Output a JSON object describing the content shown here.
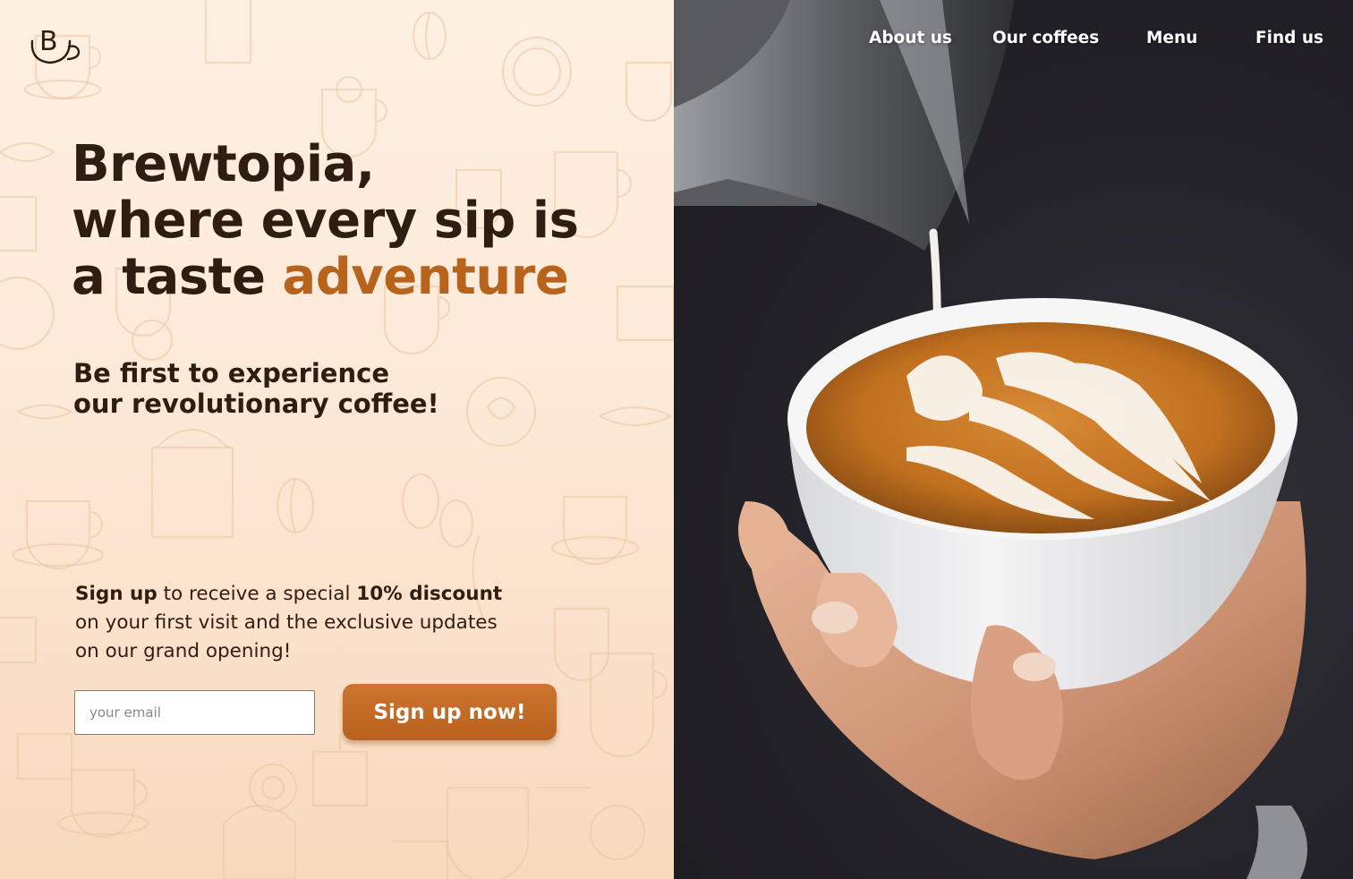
{
  "brand": {
    "logo_letter": "B"
  },
  "nav": {
    "items": [
      {
        "label": "About us"
      },
      {
        "label": "Our coffees"
      },
      {
        "label": "Menu"
      },
      {
        "label": "Find us"
      }
    ]
  },
  "hero": {
    "headline_line1": "Brewtopia,",
    "headline_line2": "where every sip is",
    "headline_line3_prefix": "a taste ",
    "headline_line3_accent": "adventure",
    "subhead_line1": "Be first to experience",
    "subhead_line2": "our revolutionary coffee!"
  },
  "signup": {
    "lead_bold": "Sign up",
    "lead_text": " to receive a special ",
    "discount_bold": "10% discount",
    "line2": "on your first visit and the exclusive updates",
    "line3": "on our grand opening!",
    "email_placeholder": "your email",
    "email_value": "",
    "button_label": "Sign up now!"
  },
  "colors": {
    "accent": "#b8631c",
    "text_dark": "#2e1d10",
    "button": "#c46b26",
    "left_bg": "#fde9d6",
    "photo_bg": "#25232a"
  },
  "icons": {
    "logo": "coffee-cup-logo-icon"
  }
}
